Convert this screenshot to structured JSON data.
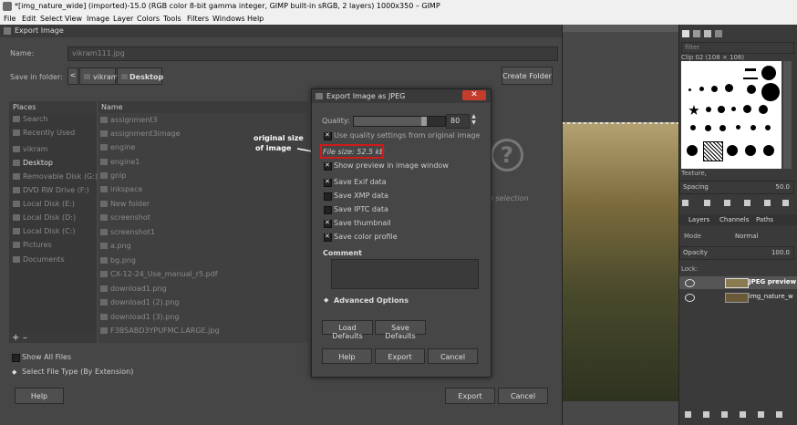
{
  "window": {
    "title": "*[img_nature_wide] (imported)-15.0 (RGB color 8-bit gamma integer, GIMP built-in sRGB, 2 layers) 1000x350 – GIMP"
  },
  "menu": [
    "File",
    "Edit",
    "Select",
    "View",
    "Image",
    "Layer",
    "Colors",
    "Tools",
    "Filters",
    "Windows",
    "Help"
  ],
  "export_dialog": {
    "title": "Export Image",
    "name_label": "Name:",
    "name_value": "vikram111.jpg",
    "save_in_label": "Save in folder:",
    "path": [
      "vikram",
      "Desktop"
    ],
    "create_folder": "Create Folder",
    "places_header": "Places",
    "places": [
      "Search",
      "Recently Used",
      "vikram",
      "Desktop",
      "Removable Disk (G:)",
      "DVD RW Drive (F:)",
      "Local Disk (E:)",
      "Local Disk (D:)",
      "Local Disk (C:)",
      "Pictures",
      "Documents"
    ],
    "name_header": "Name",
    "files": [
      "assignment3",
      "assignment3image",
      "engine",
      "engine1",
      "gnip",
      "inkspace",
      "New folder",
      "screenshot",
      "screenshot1",
      "a.png",
      "bg.png",
      "CX-12-24_Use_manual_r5.pdf",
      "download1.png",
      "download1 (2).png",
      "download1 (3).png",
      "F3BSABD3YPUFMC.LARGE.jpg"
    ],
    "add_btn": "+",
    "remove_btn": "–",
    "preview_text": "o selection",
    "show_all_files": "Show All Files",
    "select_file_type": "Select File Type (By Extension)",
    "help": "Help",
    "export": "Export",
    "cancel": "Cancel"
  },
  "jpeg_dialog": {
    "title": "Export Image as JPEG",
    "quality_label": "Quality:",
    "quality_value": "80",
    "quality_fraction": 0.8,
    "use_quality": "Use quality settings from original image",
    "file_size": "File size: 52.5 kB",
    "show_preview": "Show preview in image window",
    "save_exif": "Save Exif data",
    "save_xmp": "Save XMP data",
    "save_iptc": "Save IPTC data",
    "save_thumbnail": "Save thumbnail",
    "save_color_profile": "Save color profile",
    "comment_label": "Comment",
    "advanced": "Advanced Options",
    "load_defaults": "Load Defaults",
    "save_defaults": "Save Defaults",
    "help": "Help",
    "export": "Export",
    "cancel": "Cancel"
  },
  "annotation": {
    "line1": "original size",
    "line2": "of image"
  },
  "brushes": {
    "filter_placeholder": "filter",
    "current": "Clip 02 (108 × 108)",
    "tag": "Texture,",
    "spacing_label": "Spacing",
    "spacing_value": "50.0"
  },
  "layers": {
    "tabs": [
      "Layers",
      "Channels",
      "Paths"
    ],
    "mode_label": "Mode",
    "mode_value": "Normal",
    "opacity_label": "Opacity",
    "opacity_value": "100.0",
    "lock_label": "Lock:",
    "items": [
      "JPEG preview",
      "img_nature_w"
    ]
  },
  "colors": {
    "accent_red": "#d01a1a",
    "dialog_bg": "#464646"
  }
}
